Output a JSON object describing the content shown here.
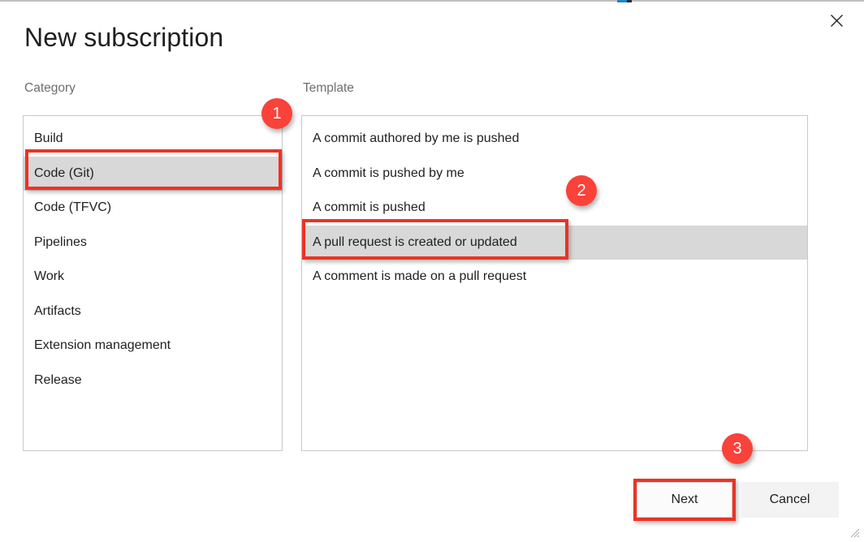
{
  "window": {
    "title": "New subscription",
    "close_icon": "close-icon",
    "resize_grip_icon": "resize-grip-icon"
  },
  "colors": {
    "annotation_red": "#ee3124",
    "badge_red": "#f9423a",
    "selection_gray": "#d8d8d8",
    "panel_border": "#c8c8c8",
    "label_gray": "#6e6e6e",
    "text": "#1f1f1f",
    "top_accent_blue": "#1e87c4"
  },
  "category": {
    "label": "Category",
    "items": [
      {
        "label": "Build",
        "selected": false
      },
      {
        "label": "Code (Git)",
        "selected": true
      },
      {
        "label": "Code (TFVC)",
        "selected": false
      },
      {
        "label": "Pipelines",
        "selected": false
      },
      {
        "label": "Work",
        "selected": false
      },
      {
        "label": "Artifacts",
        "selected": false
      },
      {
        "label": "Extension management",
        "selected": false
      },
      {
        "label": "Release",
        "selected": false
      }
    ],
    "selected_value": "Code (Git)"
  },
  "template": {
    "label": "Template",
    "items": [
      {
        "label": "A commit authored by me is pushed",
        "selected": false
      },
      {
        "label": "A commit is pushed by me",
        "selected": false
      },
      {
        "label": "A commit is pushed",
        "selected": false
      },
      {
        "label": "A pull request is created or updated",
        "selected": true
      },
      {
        "label": "A comment is made on a pull request",
        "selected": false
      }
    ],
    "selected_value": "A pull request is created or updated"
  },
  "footer": {
    "next_label": "Next",
    "cancel_label": "Cancel"
  },
  "annotations": [
    {
      "number": "1",
      "target": "category-item-code-git"
    },
    {
      "number": "2",
      "target": "template-item-pull-request"
    },
    {
      "number": "3",
      "target": "next-button"
    }
  ]
}
